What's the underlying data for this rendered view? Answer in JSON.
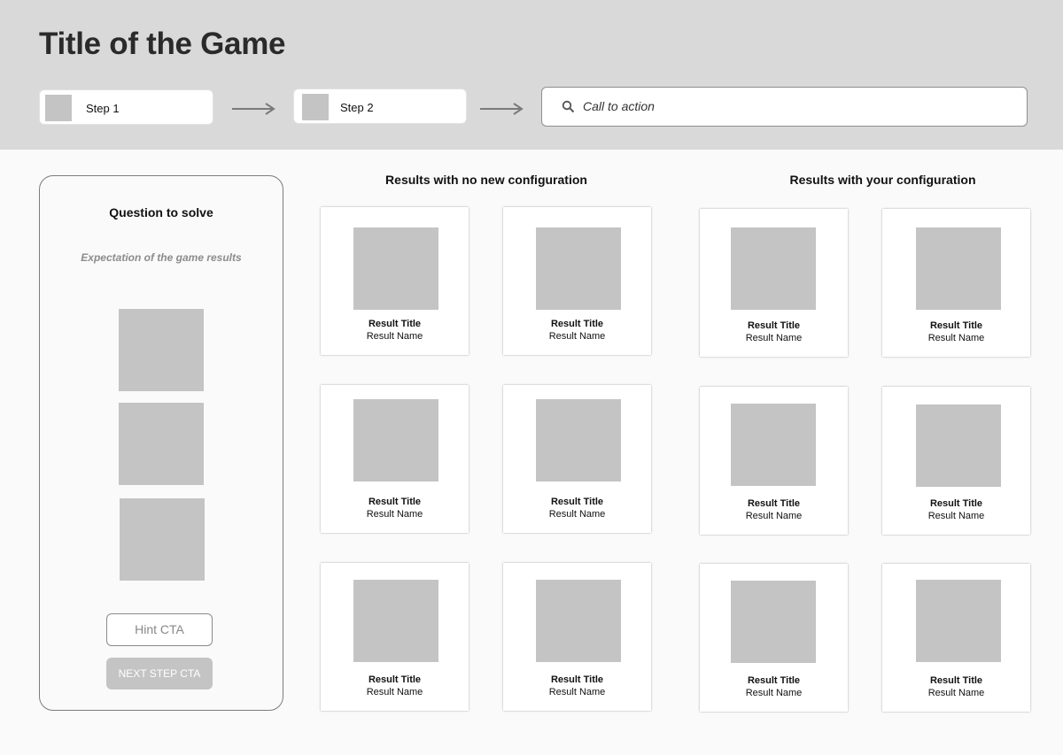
{
  "header": {
    "title": "Title of the Game",
    "steps": [
      {
        "label": "Step 1"
      },
      {
        "label": "Step 2"
      }
    ],
    "call_to_action": {
      "placeholder": "Call to action",
      "icon": "search-icon"
    }
  },
  "question_panel": {
    "title": "Question to solve",
    "subtitle": "Expectation of the game results",
    "hint_label": "Hint CTA",
    "next_label": "NEXT STEP CTA"
  },
  "results_default": {
    "heading": "Results with no new configuration",
    "cards": [
      {
        "title": "Result Title",
        "name": "Result Name"
      },
      {
        "title": "Result Title",
        "name": "Result Name"
      },
      {
        "title": "Result Title",
        "name": "Result Name"
      },
      {
        "title": "Result Title",
        "name": "Result Name"
      },
      {
        "title": "Result Title",
        "name": "Result Name"
      },
      {
        "title": "Result Title",
        "name": "Result Name"
      }
    ]
  },
  "results_config": {
    "heading": "Results with your configuration",
    "cards": [
      {
        "title": "Result Title",
        "name": "Result Name"
      },
      {
        "title": "Result Title",
        "name": "Result Name"
      },
      {
        "title": "Result Title",
        "name": "Result Name"
      },
      {
        "title": "Result Title",
        "name": "Result Name"
      },
      {
        "title": "Result Title",
        "name": "Result Name"
      },
      {
        "title": "Result Title",
        "name": "Result Name"
      }
    ]
  },
  "colors": {
    "header_bg": "#d9d9d9",
    "placeholder": "#c4c4c4",
    "page_bg": "#fafafa"
  }
}
